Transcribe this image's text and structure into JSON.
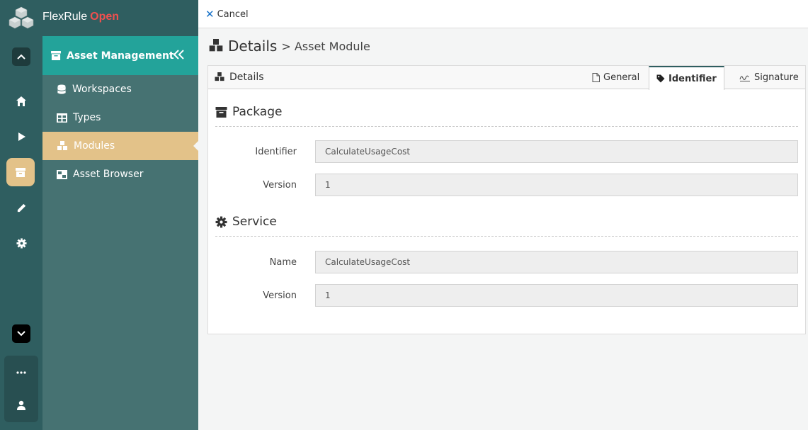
{
  "app": {
    "name": "FlexRule",
    "edition": "Open"
  },
  "panel": {
    "section_title": "Asset Management",
    "items": [
      {
        "label": "Workspaces",
        "icon": "database-icon"
      },
      {
        "label": "Types",
        "icon": "table-icon"
      },
      {
        "label": "Modules",
        "icon": "cubes-icon",
        "active": true
      },
      {
        "label": "Asset Browser",
        "icon": "browser-icon"
      }
    ]
  },
  "rail": {
    "items": [
      "collapse-up-icon",
      "home-icon",
      "play-icon",
      "archive-icon",
      "pencil-icon",
      "gear-icon",
      "expand-down-icon",
      "more-icon",
      "user-icon"
    ]
  },
  "topbar": {
    "cancel_label": "Cancel"
  },
  "page": {
    "title": "Details",
    "breadcrumb": "> Asset Module"
  },
  "card": {
    "title": "Details",
    "tabs": [
      {
        "label": "General",
        "icon": "file-icon"
      },
      {
        "label": "Identifier",
        "icon": "tag-icon",
        "active": true
      },
      {
        "label": "Signature",
        "icon": "signature-icon"
      }
    ]
  },
  "package": {
    "title": "Package",
    "identifier_label": "Identifier",
    "identifier_value": "CalculateUsageCost",
    "version_label": "Version",
    "version_value": "1"
  },
  "service": {
    "title": "Service",
    "name_label": "Name",
    "name_value": "CalculateUsageCost",
    "version_label": "Version",
    "version_value": "1"
  },
  "colors": {
    "rail": "#2f5e60",
    "panel": "#467272",
    "section": "#23a39a",
    "active": "#e3c289",
    "brand_accent": "#f0504f"
  }
}
